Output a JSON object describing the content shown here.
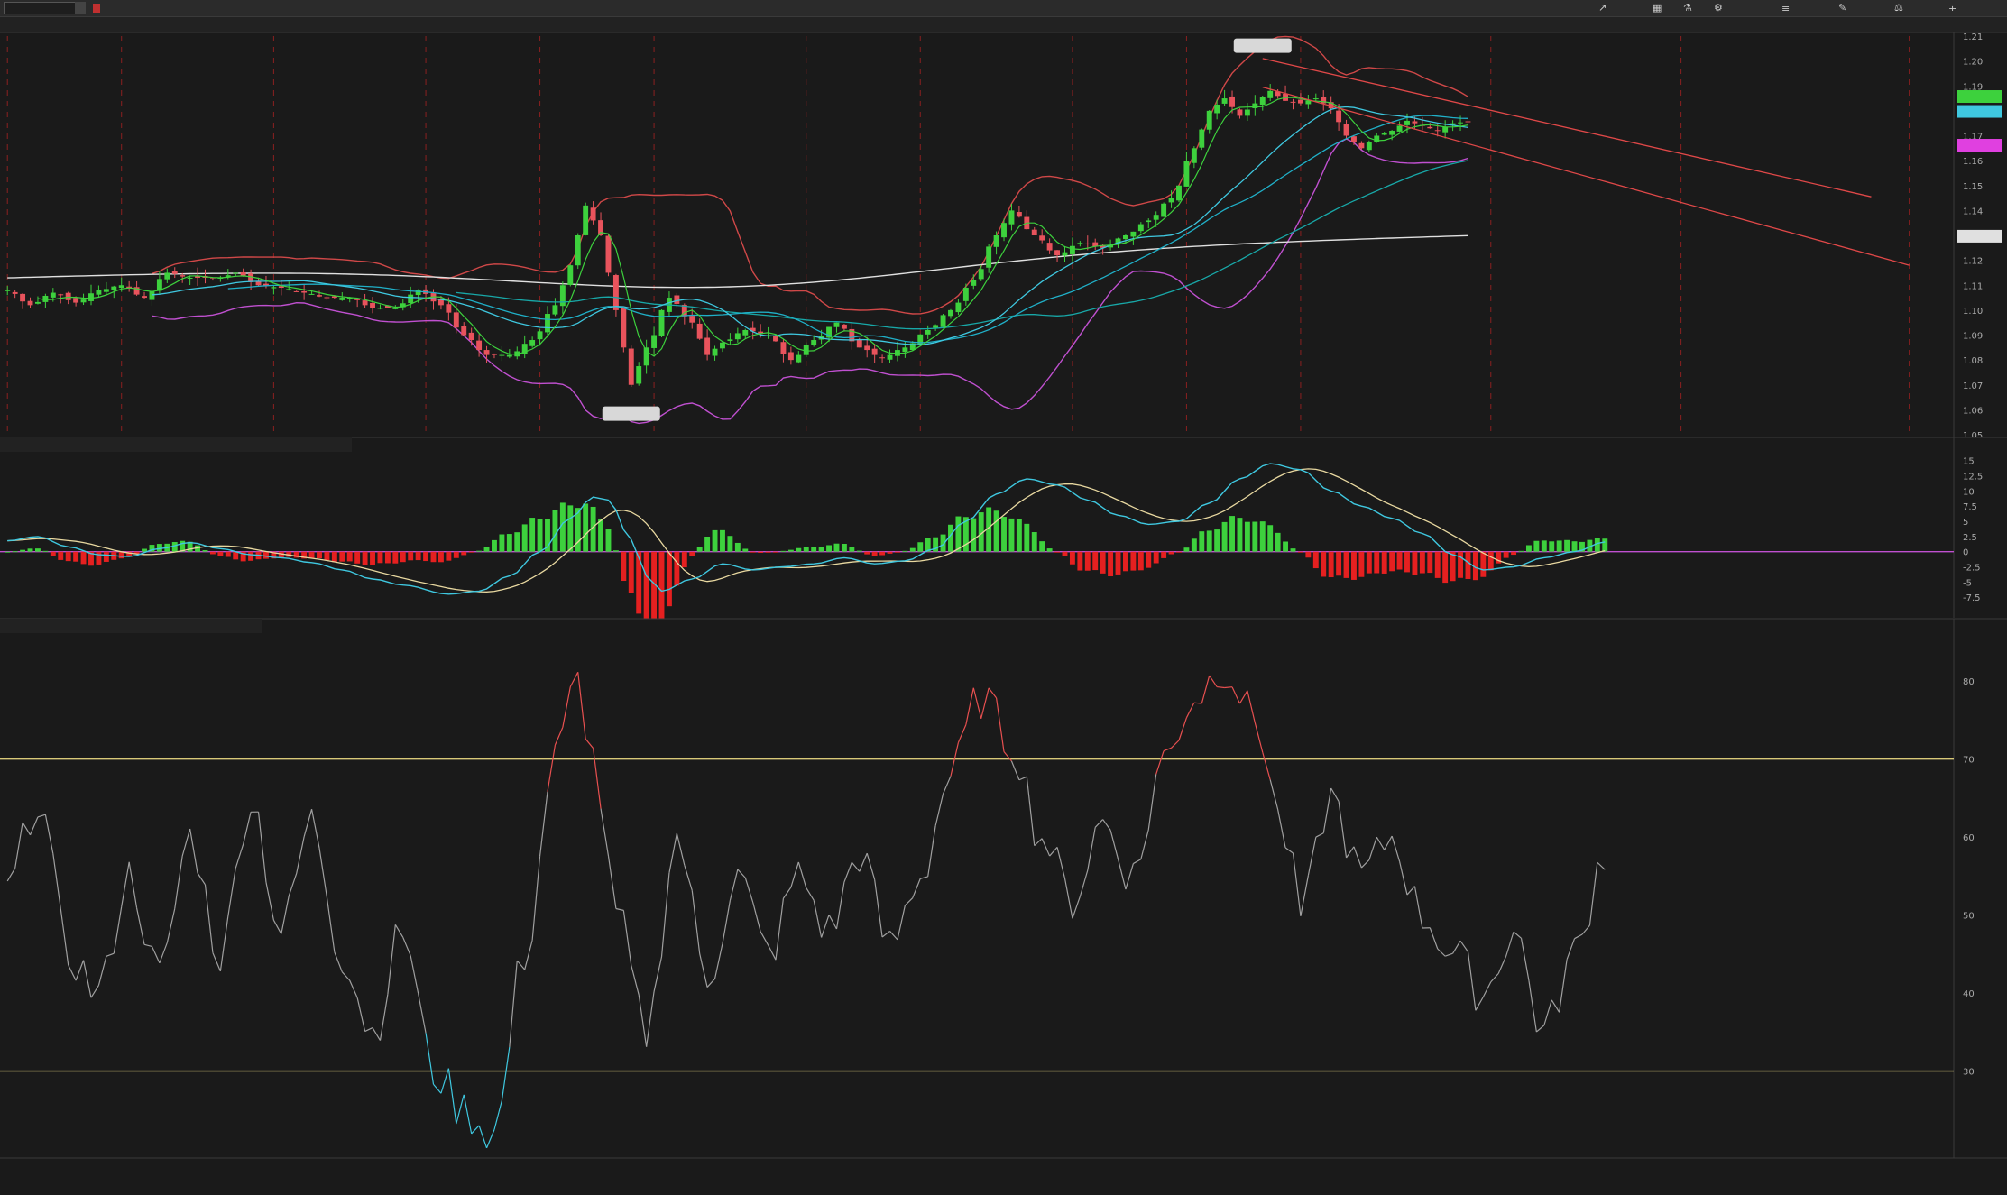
{
  "toolbar": {
    "symbol": "",
    "description": "",
    "price": "",
    "change_line1": "",
    "change_line2": "",
    "bid_line1": "",
    "ask_line2": "",
    "share_label": "",
    "style_label": "",
    "drawing_label": "",
    "study_label": "",
    "pattern_label": "",
    "period_label": ""
  },
  "infobar": {
    "symbol_period": "",
    "date": "",
    "open": "",
    "high": "",
    "low": "",
    "close": "",
    "range": "",
    "sma5_label": "",
    "sma5_value": "",
    "sma60_label": "",
    "sma60_value": "",
    "sma20_label": "",
    "sma20_value": "",
    "sma200_label": "",
    "sma200_value": "",
    "sma30_label": "",
    "sma30_value": "",
    "bb_label": "",
    "bb_mid": "",
    "bb_lower": "",
    "bb_upper": ""
  },
  "colors": {
    "background": "#1a1a1a",
    "up_candle": "#3dd13d",
    "down_candle": "#e8535c",
    "macd_line": "#3fc8e0",
    "signal_line": "#e8d8a0",
    "hist_up": "#3dd13d",
    "hist_down": "#e52020",
    "rsi_line": "#a0a0a0",
    "rsi_ob": "#e85050",
    "rsi_os": "#3fc8e0",
    "bb_upper": "#d04848",
    "bb_lower": "#c050d0",
    "sma5": "#3dd13d",
    "sma20": "#3fc8e0",
    "sma30": "#20b0c8",
    "sma60": "#18a8a8",
    "sma200": "#e0e0e0",
    "zero_line": "#c050d0",
    "level_line": "#d8c878",
    "trend_line": "#e04848"
  },
  "macd": {
    "label": "",
    "value": "",
    "avg": "",
    "diff": "",
    "zero": ""
  },
  "rsi": {
    "label": "",
    "value": "",
    "ob": "",
    "os": ""
  },
  "chart_data": {
    "type": "candlestick",
    "symbol": "",
    "ylim": [
      1.05,
      1.21
    ],
    "price_ticks": [
      1.05,
      1.06,
      1.07,
      1.08,
      1.09,
      1.1,
      1.11,
      1.12,
      1.13,
      1.14,
      1.15,
      1.16,
      1.17,
      1.18,
      1.19,
      1.2,
      1.21
    ],
    "x_labels": [
      "",
      "",
      "",
      "",
      "",
      "",
      "",
      "",
      "",
      "",
      "",
      "",
      "",
      "",
      "",
      "",
      "",
      "",
      "",
      "",
      "",
      "",
      "",
      "",
      "",
      "",
      "",
      "",
      "",
      "",
      "",
      "",
      "",
      "",
      "",
      "",
      "",
      "",
      "",
      ""
    ],
    "x_label_idx": [
      0,
      5,
      10,
      15,
      20,
      30,
      35,
      40,
      50,
      55,
      60,
      65,
      70,
      75,
      80,
      85,
      95,
      100,
      105,
      110,
      115,
      120,
      125,
      135,
      140,
      145,
      150,
      155,
      160,
      165,
      170,
      180,
      190,
      195,
      200,
      210,
      220,
      230,
      240,
      250
    ],
    "price_labels": [
      {
        "idx": 165,
        "value": 1.20107,
        "text": ""
      },
      {
        "idx": 82,
        "value": 1.06355,
        "text": ""
      }
    ],
    "right_labels": [
      {
        "value": 1.18574,
        "text": "",
        "color": "#3dd13d"
      },
      {
        "value": 1.17976,
        "text": "",
        "color": "#3fc8e0"
      },
      {
        "value": 1.16619,
        "text": "",
        "color": "#e040e0"
      },
      {
        "value": 1.12967,
        "text": "",
        "color": "#e0e0e0"
      }
    ],
    "trendlines": [
      {
        "i0": 165,
        "v0": 1.201,
        "i1": 245,
        "v1": 1.1455
      },
      {
        "i0": 165,
        "v0": 1.1895,
        "i1": 250,
        "v1": 1.118
      }
    ],
    "anchors": [
      [
        0,
        1.108
      ],
      [
        3,
        1.102
      ],
      [
        6,
        1.107
      ],
      [
        9,
        1.103
      ],
      [
        12,
        1.108
      ],
      [
        15,
        1.11
      ],
      [
        18,
        1.105
      ],
      [
        21,
        1.115
      ],
      [
        24,
        1.113
      ],
      [
        28,
        1.113
      ],
      [
        30,
        1.115
      ],
      [
        33,
        1.11
      ],
      [
        36,
        1.109
      ],
      [
        39,
        1.107
      ],
      [
        42,
        1.105
      ],
      [
        45,
        1.105
      ],
      [
        48,
        1.101
      ],
      [
        51,
        1.101
      ],
      [
        54,
        1.108
      ],
      [
        57,
        1.102
      ],
      [
        60,
        1.09
      ],
      [
        63,
        1.082
      ],
      [
        66,
        1.082
      ],
      [
        69,
        1.088
      ],
      [
        72,
        1.102
      ],
      [
        74,
        1.118
      ],
      [
        76,
        1.142
      ],
      [
        78,
        1.13
      ],
      [
        80,
        1.1
      ],
      [
        82,
        1.07
      ],
      [
        84,
        1.085
      ],
      [
        87,
        1.105
      ],
      [
        90,
        1.095
      ],
      [
        92,
        1.082
      ],
      [
        94,
        1.087
      ],
      [
        97,
        1.092
      ],
      [
        100,
        1.09
      ],
      [
        103,
        1.08
      ],
      [
        106,
        1.088
      ],
      [
        109,
        1.095
      ],
      [
        112,
        1.085
      ],
      [
        115,
        1.081
      ],
      [
        118,
        1.085
      ],
      [
        121,
        1.092
      ],
      [
        124,
        1.1
      ],
      [
        127,
        1.112
      ],
      [
        130,
        1.13
      ],
      [
        132,
        1.14
      ],
      [
        135,
        1.13
      ],
      [
        138,
        1.122
      ],
      [
        141,
        1.127
      ],
      [
        144,
        1.125
      ],
      [
        147,
        1.13
      ],
      [
        150,
        1.136
      ],
      [
        153,
        1.145
      ],
      [
        156,
        1.165
      ],
      [
        158,
        1.18
      ],
      [
        160,
        1.185
      ],
      [
        162,
        1.178
      ],
      [
        164,
        1.183
      ],
      [
        166,
        1.188
      ],
      [
        168,
        1.184
      ],
      [
        170,
        1.183
      ],
      [
        172,
        1.185
      ],
      [
        174,
        1.181
      ],
      [
        176,
        1.17
      ],
      [
        178,
        1.165
      ],
      [
        180,
        1.17
      ],
      [
        182,
        1.172
      ],
      [
        184,
        1.176
      ],
      [
        186,
        1.174
      ],
      [
        188,
        1.172
      ],
      [
        190,
        1.175
      ],
      [
        192,
        1.1757
      ]
    ],
    "macd_anchors": [
      [
        0,
        1.8
      ],
      [
        4,
        2.5
      ],
      [
        8,
        0.8
      ],
      [
        12,
        -0.5
      ],
      [
        16,
        -0.8
      ],
      [
        20,
        0.5
      ],
      [
        24,
        1.5
      ],
      [
        28,
        0.5
      ],
      [
        32,
        -0.5
      ],
      [
        36,
        -1.0
      ],
      [
        40,
        -1.8
      ],
      [
        44,
        -3.0
      ],
      [
        48,
        -4.5
      ],
      [
        52,
        -5.5
      ],
      [
        58,
        -7.0
      ],
      [
        62,
        -6.5
      ],
      [
        66,
        -4.0
      ],
      [
        70,
        0.0
      ],
      [
        74,
        5.5
      ],
      [
        77,
        9.0
      ],
      [
        79,
        8.5
      ],
      [
        82,
        2.0
      ],
      [
        84,
        -4.0
      ],
      [
        86,
        -6.5
      ],
      [
        90,
        -4.5
      ],
      [
        94,
        -2.0
      ],
      [
        98,
        -3.0
      ],
      [
        102,
        -2.5
      ],
      [
        106,
        -2.0
      ],
      [
        110,
        -1.0
      ],
      [
        114,
        -2.0
      ],
      [
        118,
        -1.5
      ],
      [
        122,
        0.5
      ],
      [
        126,
        5.0
      ],
      [
        130,
        9.5
      ],
      [
        134,
        12.0
      ],
      [
        138,
        11.0
      ],
      [
        142,
        8.5
      ],
      [
        146,
        6.0
      ],
      [
        150,
        4.5
      ],
      [
        154,
        5.0
      ],
      [
        158,
        8.0
      ],
      [
        162,
        12.0
      ],
      [
        166,
        14.5
      ],
      [
        170,
        13.5
      ],
      [
        174,
        10.0
      ],
      [
        178,
        7.5
      ],
      [
        182,
        5.5
      ],
      [
        186,
        3.0
      ],
      [
        190,
        -0.5
      ],
      [
        194,
        -3.0
      ],
      [
        198,
        -2.5
      ],
      [
        202,
        -1.0
      ],
      [
        206,
        0.0
      ],
      [
        210,
        1.6
      ]
    ],
    "rsi_anchors": [
      [
        0,
        53
      ],
      [
        4,
        65
      ],
      [
        8,
        45
      ],
      [
        12,
        40
      ],
      [
        16,
        55
      ],
      [
        20,
        42
      ],
      [
        24,
        60
      ],
      [
        28,
        45
      ],
      [
        32,
        65
      ],
      [
        36,
        48
      ],
      [
        40,
        62
      ],
      [
        44,
        45
      ],
      [
        48,
        35
      ],
      [
        52,
        48
      ],
      [
        56,
        30
      ],
      [
        60,
        25
      ],
      [
        64,
        22
      ],
      [
        68,
        45
      ],
      [
        72,
        70
      ],
      [
        75,
        80
      ],
      [
        77,
        70
      ],
      [
        80,
        50
      ],
      [
        84,
        35
      ],
      [
        88,
        60
      ],
      [
        92,
        42
      ],
      [
        96,
        55
      ],
      [
        100,
        45
      ],
      [
        104,
        55
      ],
      [
        108,
        48
      ],
      [
        112,
        58
      ],
      [
        116,
        46
      ],
      [
        120,
        55
      ],
      [
        124,
        68
      ],
      [
        128,
        78
      ],
      [
        132,
        72
      ],
      [
        136,
        60
      ],
      [
        140,
        52
      ],
      [
        144,
        62
      ],
      [
        148,
        55
      ],
      [
        152,
        70
      ],
      [
        156,
        78
      ],
      [
        160,
        82
      ],
      [
        164,
        75
      ],
      [
        168,
        60
      ],
      [
        170,
        50
      ],
      [
        174,
        65
      ],
      [
        178,
        55
      ],
      [
        182,
        60
      ],
      [
        186,
        50
      ],
      [
        190,
        45
      ],
      [
        194,
        40
      ],
      [
        198,
        48
      ],
      [
        202,
        35
      ],
      [
        206,
        45
      ],
      [
        210,
        58
      ]
    ]
  }
}
